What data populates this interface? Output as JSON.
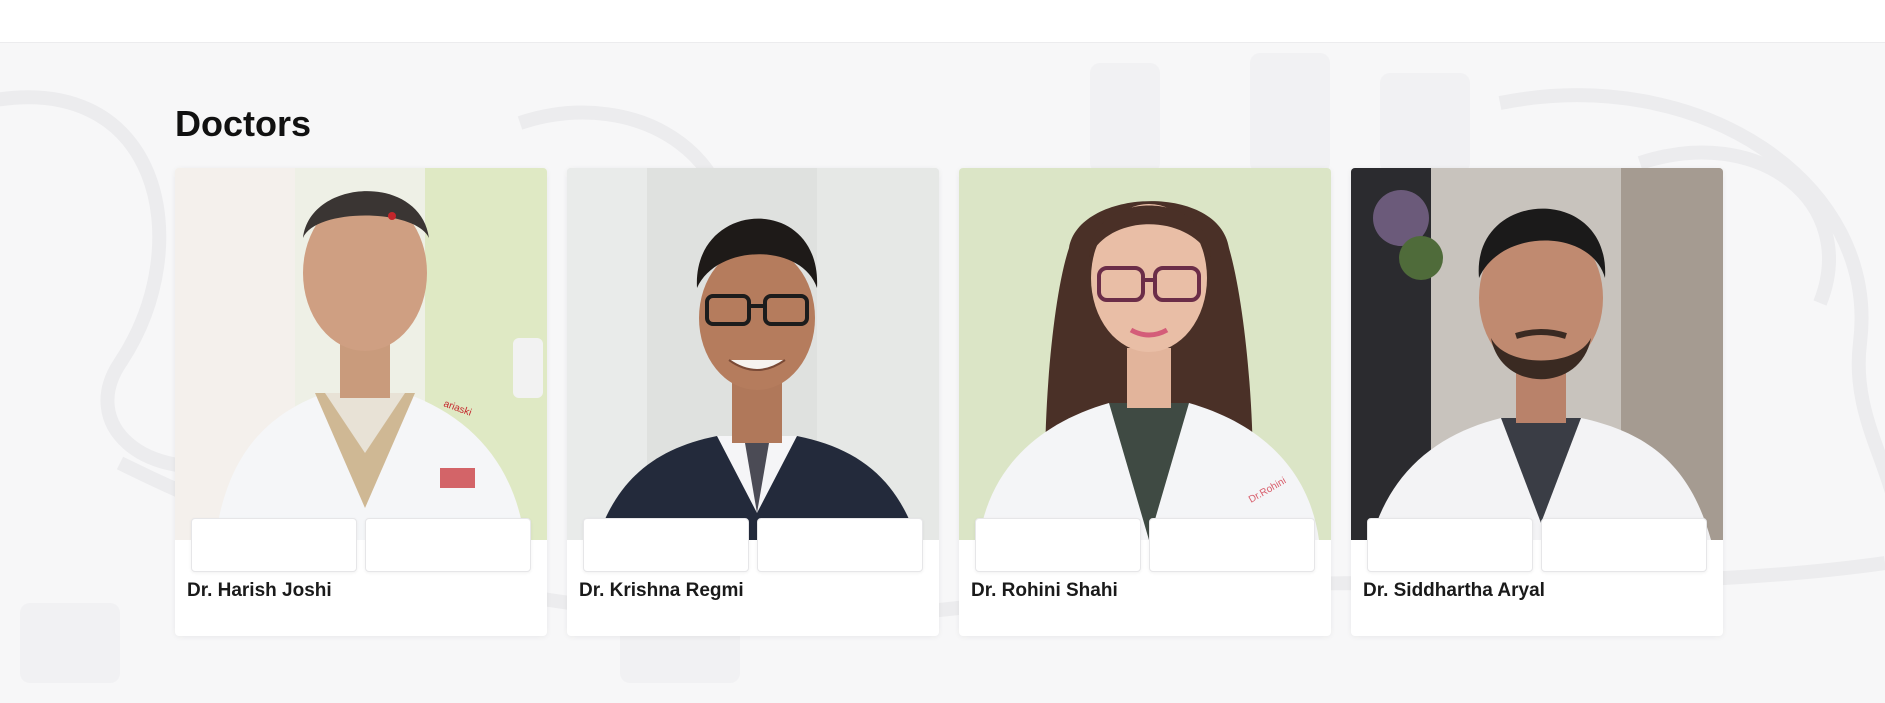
{
  "section": {
    "title": "Doctors"
  },
  "doctors": [
    {
      "name": "Dr. Harish Joshi",
      "coat_text": "ariaski"
    },
    {
      "name": "Dr. Krishna Regmi"
    },
    {
      "name": "Dr. Rohini Shahi",
      "coat_text": "Dr.Rohini"
    },
    {
      "name": "Dr. Siddhartha Aryal"
    }
  ],
  "colors": {
    "page_bg": "#f7f7f8",
    "card_bg": "#ffffff",
    "heading": "#111111",
    "name_text": "#1a1a1a"
  }
}
